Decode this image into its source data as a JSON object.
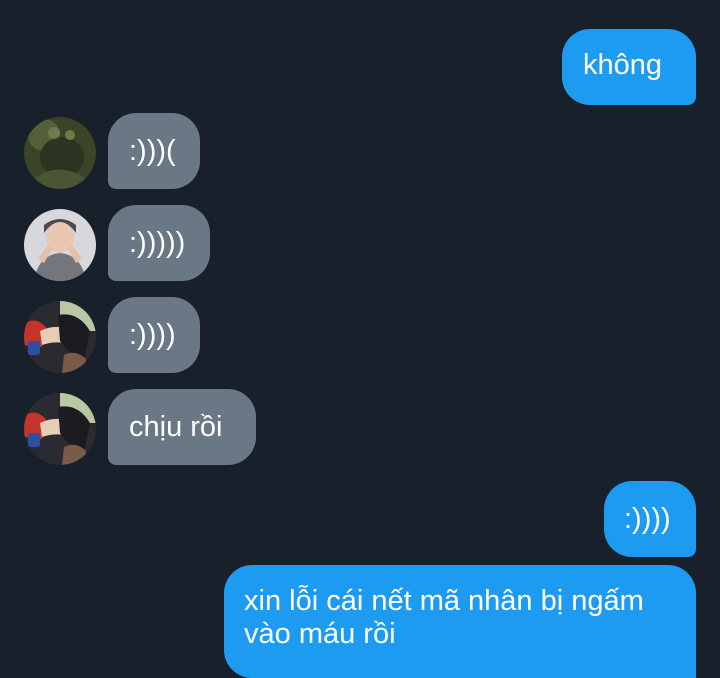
{
  "messages": [
    {
      "text": "không"
    },
    {
      "text": ":)))("
    },
    {
      "text": ":)))))"
    },
    {
      "text": ":))))"
    },
    {
      "text": "chịu rồi"
    },
    {
      "text": ":))))"
    },
    {
      "text": "xin lỗi cái nết mã nhân bị ngấm vào máu rồi"
    }
  ],
  "avatars": [
    "green-creature-avatar",
    "person-avatar",
    "anime-avatar",
    "anime-avatar"
  ],
  "colors": {
    "background": "#18202b",
    "outgoing_bubble": "#1d9bf0",
    "incoming_bubble": "#6a7784",
    "text": "#ffffff"
  }
}
